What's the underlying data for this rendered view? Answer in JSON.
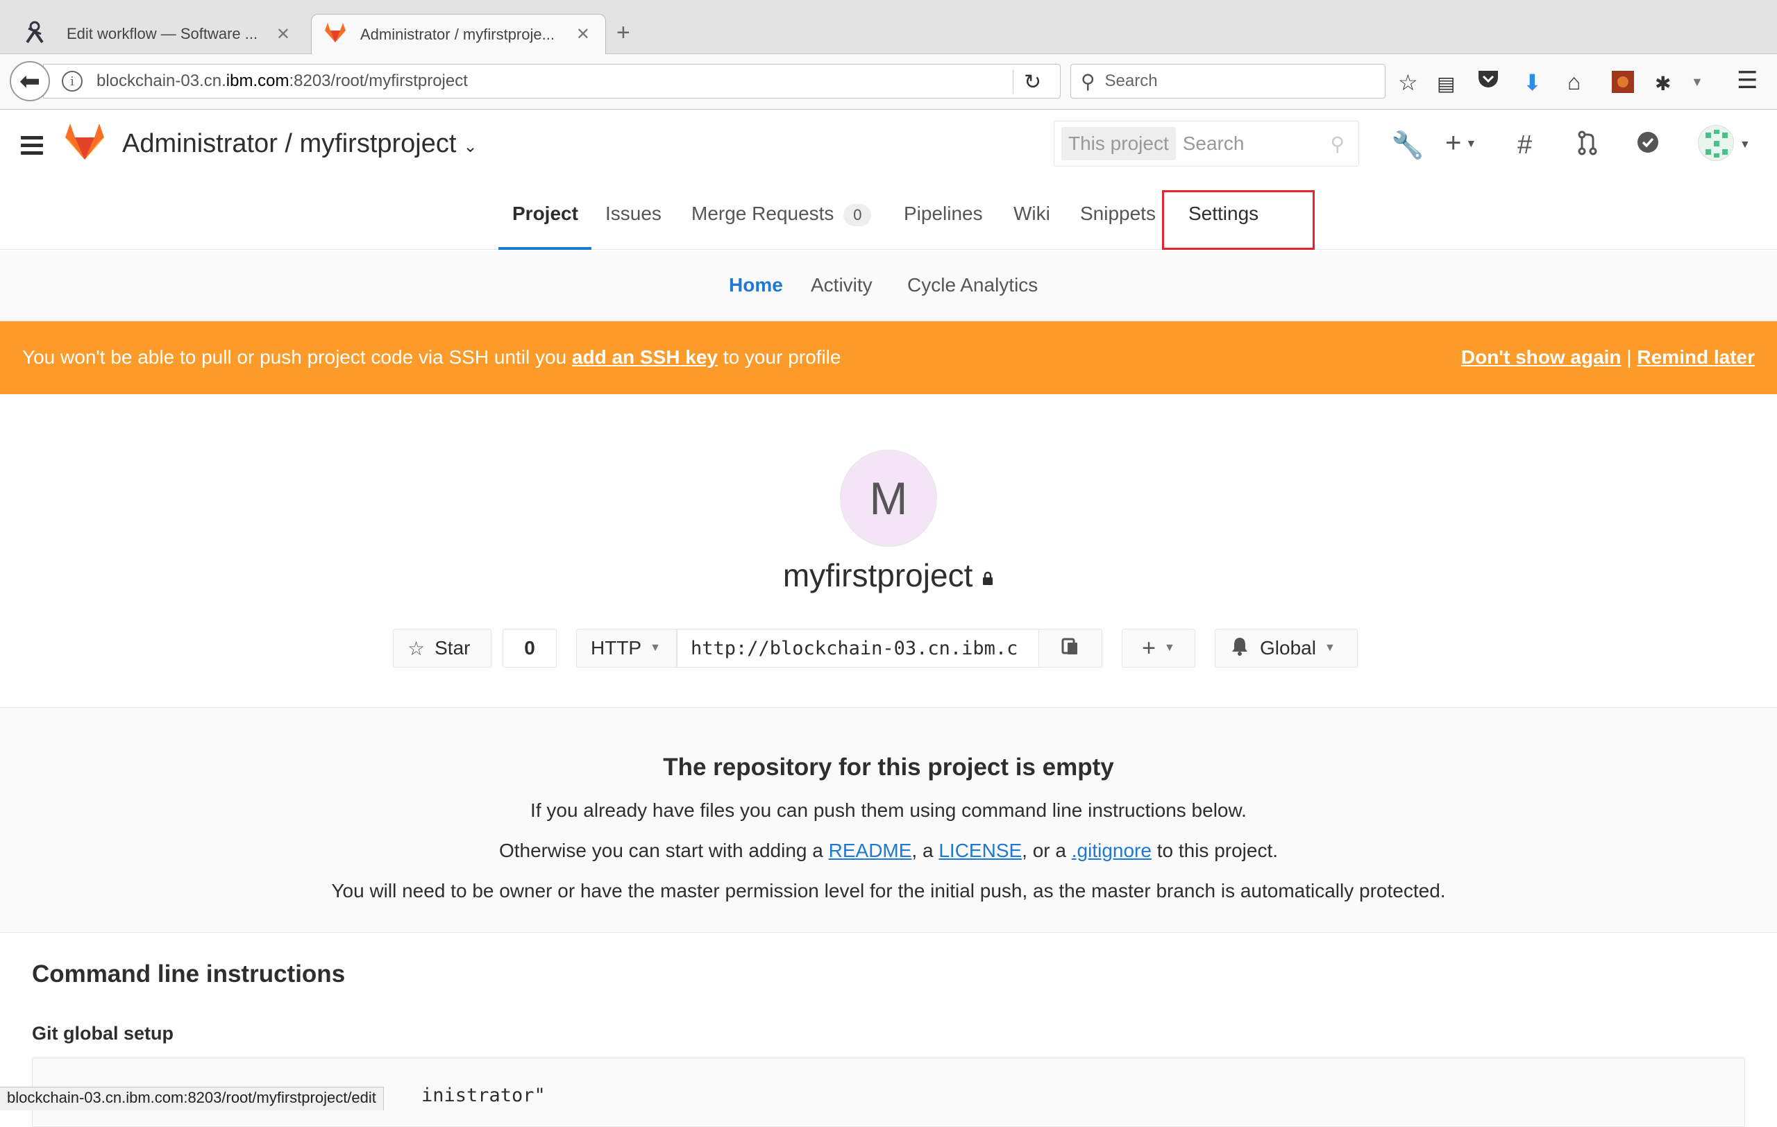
{
  "browser": {
    "tabs": [
      {
        "title": "Edit workflow — Software ...",
        "icon": "jenkins-icon"
      },
      {
        "title": "Administrator / myfirstproje...",
        "icon": "gitlab-icon"
      }
    ],
    "url_prefix": "blockchain-03.cn.",
    "url_host": "ibm.com",
    "url_suffix": ":8203/root/myfirstproject",
    "search_placeholder": "Search",
    "status_url": "blockchain-03.cn.ibm.com:8203/root/myfirstproject/edit"
  },
  "header": {
    "project_path": "Administrator / myfirstproject",
    "search_scope": "This project",
    "search_placeholder": "Search"
  },
  "tabs": [
    {
      "label": "Project",
      "active": true
    },
    {
      "label": "Issues"
    },
    {
      "label": "Merge Requests",
      "count": "0"
    },
    {
      "label": "Pipelines"
    },
    {
      "label": "Wiki"
    },
    {
      "label": "Snippets"
    },
    {
      "label": "Settings"
    }
  ],
  "subtabs": [
    "Home",
    "Activity",
    "Cycle Analytics"
  ],
  "alert": {
    "text_before": "You won't be able to pull or push project code via SSH until you ",
    "link": "add an SSH key",
    "text_after": " to your profile",
    "dont_show": "Don't show again",
    "sep": "|",
    "remind": "Remind later",
    "color": "#fc9a2a"
  },
  "project": {
    "initial": "M",
    "name": "myfirstproject",
    "star_label": "Star",
    "star_count": "0",
    "protocol": "HTTP",
    "clone_url": "http://blockchain-03.cn.ibm.c",
    "notification": "Global"
  },
  "empty": {
    "heading": "The repository for this project is empty",
    "line1": "If you already have files you can push them using command line instructions below.",
    "line2_a": "Otherwise you can start with adding a ",
    "readme": "README",
    "comma1": ", a ",
    "license": "LICENSE",
    "comma2": ", or a ",
    "gitignore": ".gitignore",
    "line2_b": " to this project.",
    "line3": "You will need to be owner or have the master permission level for the initial push, as the master branch is automatically protected."
  },
  "cli": {
    "title": "Command line instructions",
    "git_global": "Git global setup",
    "code_fragment": "inistrator\""
  }
}
